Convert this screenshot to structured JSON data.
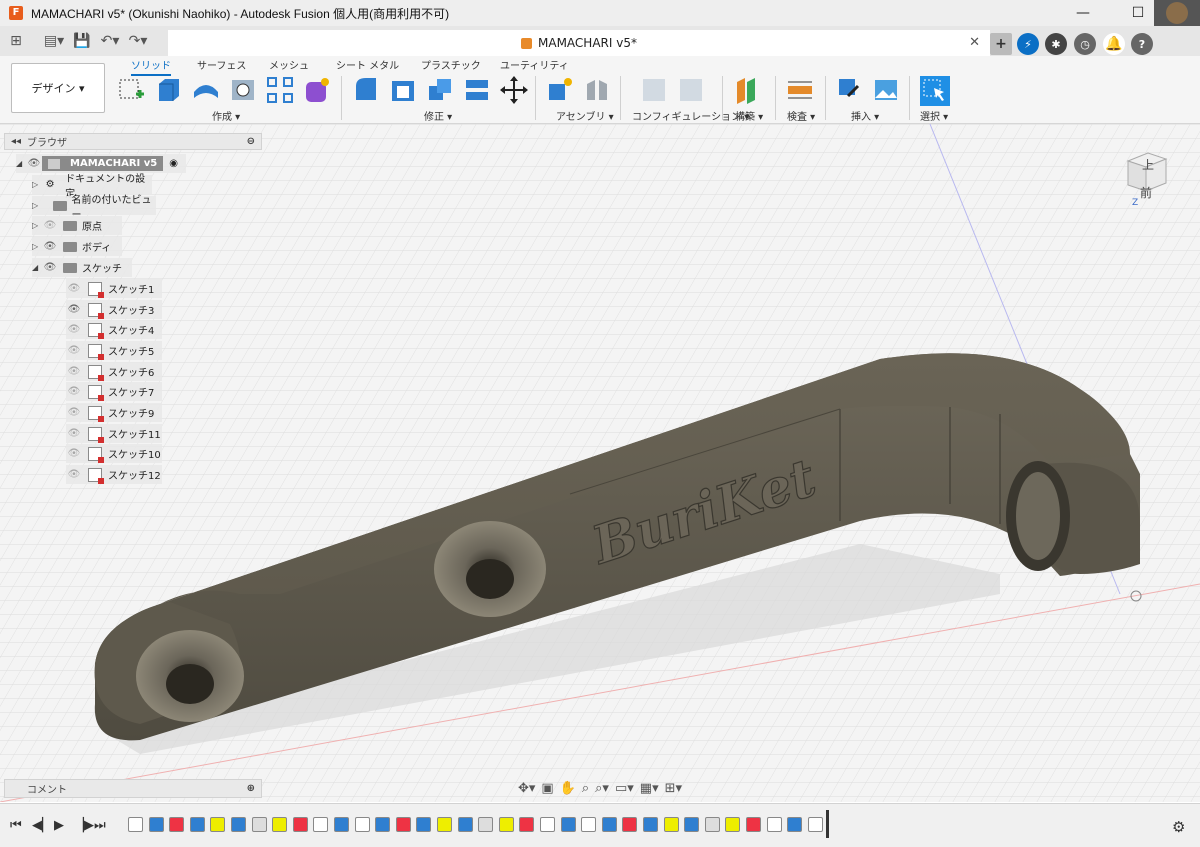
{
  "window": {
    "title": "MAMACHARI v5* (Okunishi Naohiko) - Autodesk Fusion 個人用(商用利用不可)",
    "minimize": "—",
    "maximize": "☐",
    "close": "✕"
  },
  "tab": {
    "title": "MAMACHARI v5*",
    "close": "✕"
  },
  "toolbar": {
    "workspace": "デザイン ▾",
    "tabs": [
      "ソリッド",
      "サーフェス",
      "メッシュ",
      "シート メタル",
      "プラスチック",
      "ユーティリティ"
    ],
    "groups": [
      "作成 ▾",
      "修正 ▾",
      "アセンブリ ▾",
      "コンフィギュレーション ▾",
      "構築 ▾",
      "検査 ▾",
      "挿入 ▾",
      "選択 ▾"
    ]
  },
  "browser": {
    "title": "ブラウザ",
    "root": "MAMACHARI v5",
    "items": [
      "ドキュメントの設定",
      "名前の付いたビュー",
      "原点",
      "ボディ",
      "スケッチ"
    ],
    "sketches": [
      "スケッチ1",
      "スケッチ3",
      "スケッチ4",
      "スケッチ5",
      "スケッチ6",
      "スケッチ7",
      "スケッチ9",
      "スケッチ11",
      "スケッチ10",
      "スケッチ12"
    ]
  },
  "viewcube": {
    "top": "上",
    "front": "前",
    "axis": "Z"
  },
  "model": {
    "emboss_text": "BuriKet"
  },
  "comment": {
    "label": "コメント"
  },
  "colors": {
    "accent": "#0b6fc5",
    "body": "#6b6558",
    "grid": "#dcdcdc"
  }
}
